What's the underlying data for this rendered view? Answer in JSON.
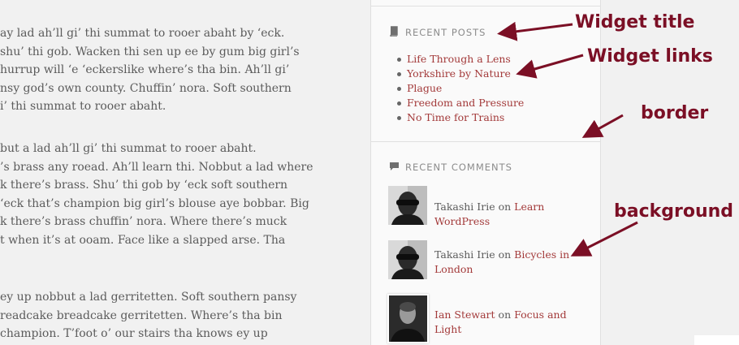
{
  "content": {
    "paragraphs": [
      [
        "ay lad ah’ll gi’ thi summat to rooer abaht by ‘eck.",
        "shu’ thi gob. Wacken thi sen up ee by gum big girl’s",
        "hurrup will ‘e ‘eckerslike where’s tha bin. Ah’ll gi’",
        "nsy god’s own county. Chuffin’ nora. Soft southern",
        "i’ thi summat to rooer abaht."
      ],
      [
        "but a lad ah’ll gi’ thi summat to rooer abaht.",
        "’s brass any roead. Ah’ll learn thi. Nobbut a lad where",
        "k there’s brass. Shu’ thi gob by ‘eck soft southern",
        "‘eck that’s champion big girl’s blouse aye bobbar. Big",
        "k there’s brass chuffin’ nora. Where there’s muck",
        "t when it’s at ooam. Face like a slapped arse. Tha"
      ],
      [
        "ey up nobbut a lad gerritetten. Soft southern pansy",
        "readcake breadcake gerritetten. Where’s tha bin",
        "champion. T’foot o’ our stairs tha knows ey up"
      ]
    ]
  },
  "sidebar": {
    "recent_posts": {
      "icon": "book-icon",
      "title": "RECENT POSTS",
      "items": [
        "Life Through a Lens",
        "Yorkshire by Nature",
        "Plague",
        "Freedom and Pressure",
        "No Time for Trains"
      ]
    },
    "recent_comments": {
      "icon": "speech-bubble-icon",
      "title": "RECENT COMMENTS",
      "items": [
        {
          "author": "Takashi Irie",
          "on": "on",
          "post": "Learn WordPress"
        },
        {
          "author": "Takashi Irie",
          "on": "on",
          "post": "Bicycles in London"
        },
        {
          "author": "Ian Stewart",
          "on": "on",
          "post": "Focus and Light"
        }
      ]
    }
  },
  "annotations": {
    "widget_title": "Widget title",
    "widget_links": "Widget links",
    "border": "border",
    "background": "background",
    "color": "#7b0f25"
  },
  "colors": {
    "link": "#a33a3a",
    "body_text": "#5b5b5b",
    "muted": "#8c8c8c",
    "page_bg": "#f1f1f1",
    "sidebar_bg": "#fafafa"
  }
}
